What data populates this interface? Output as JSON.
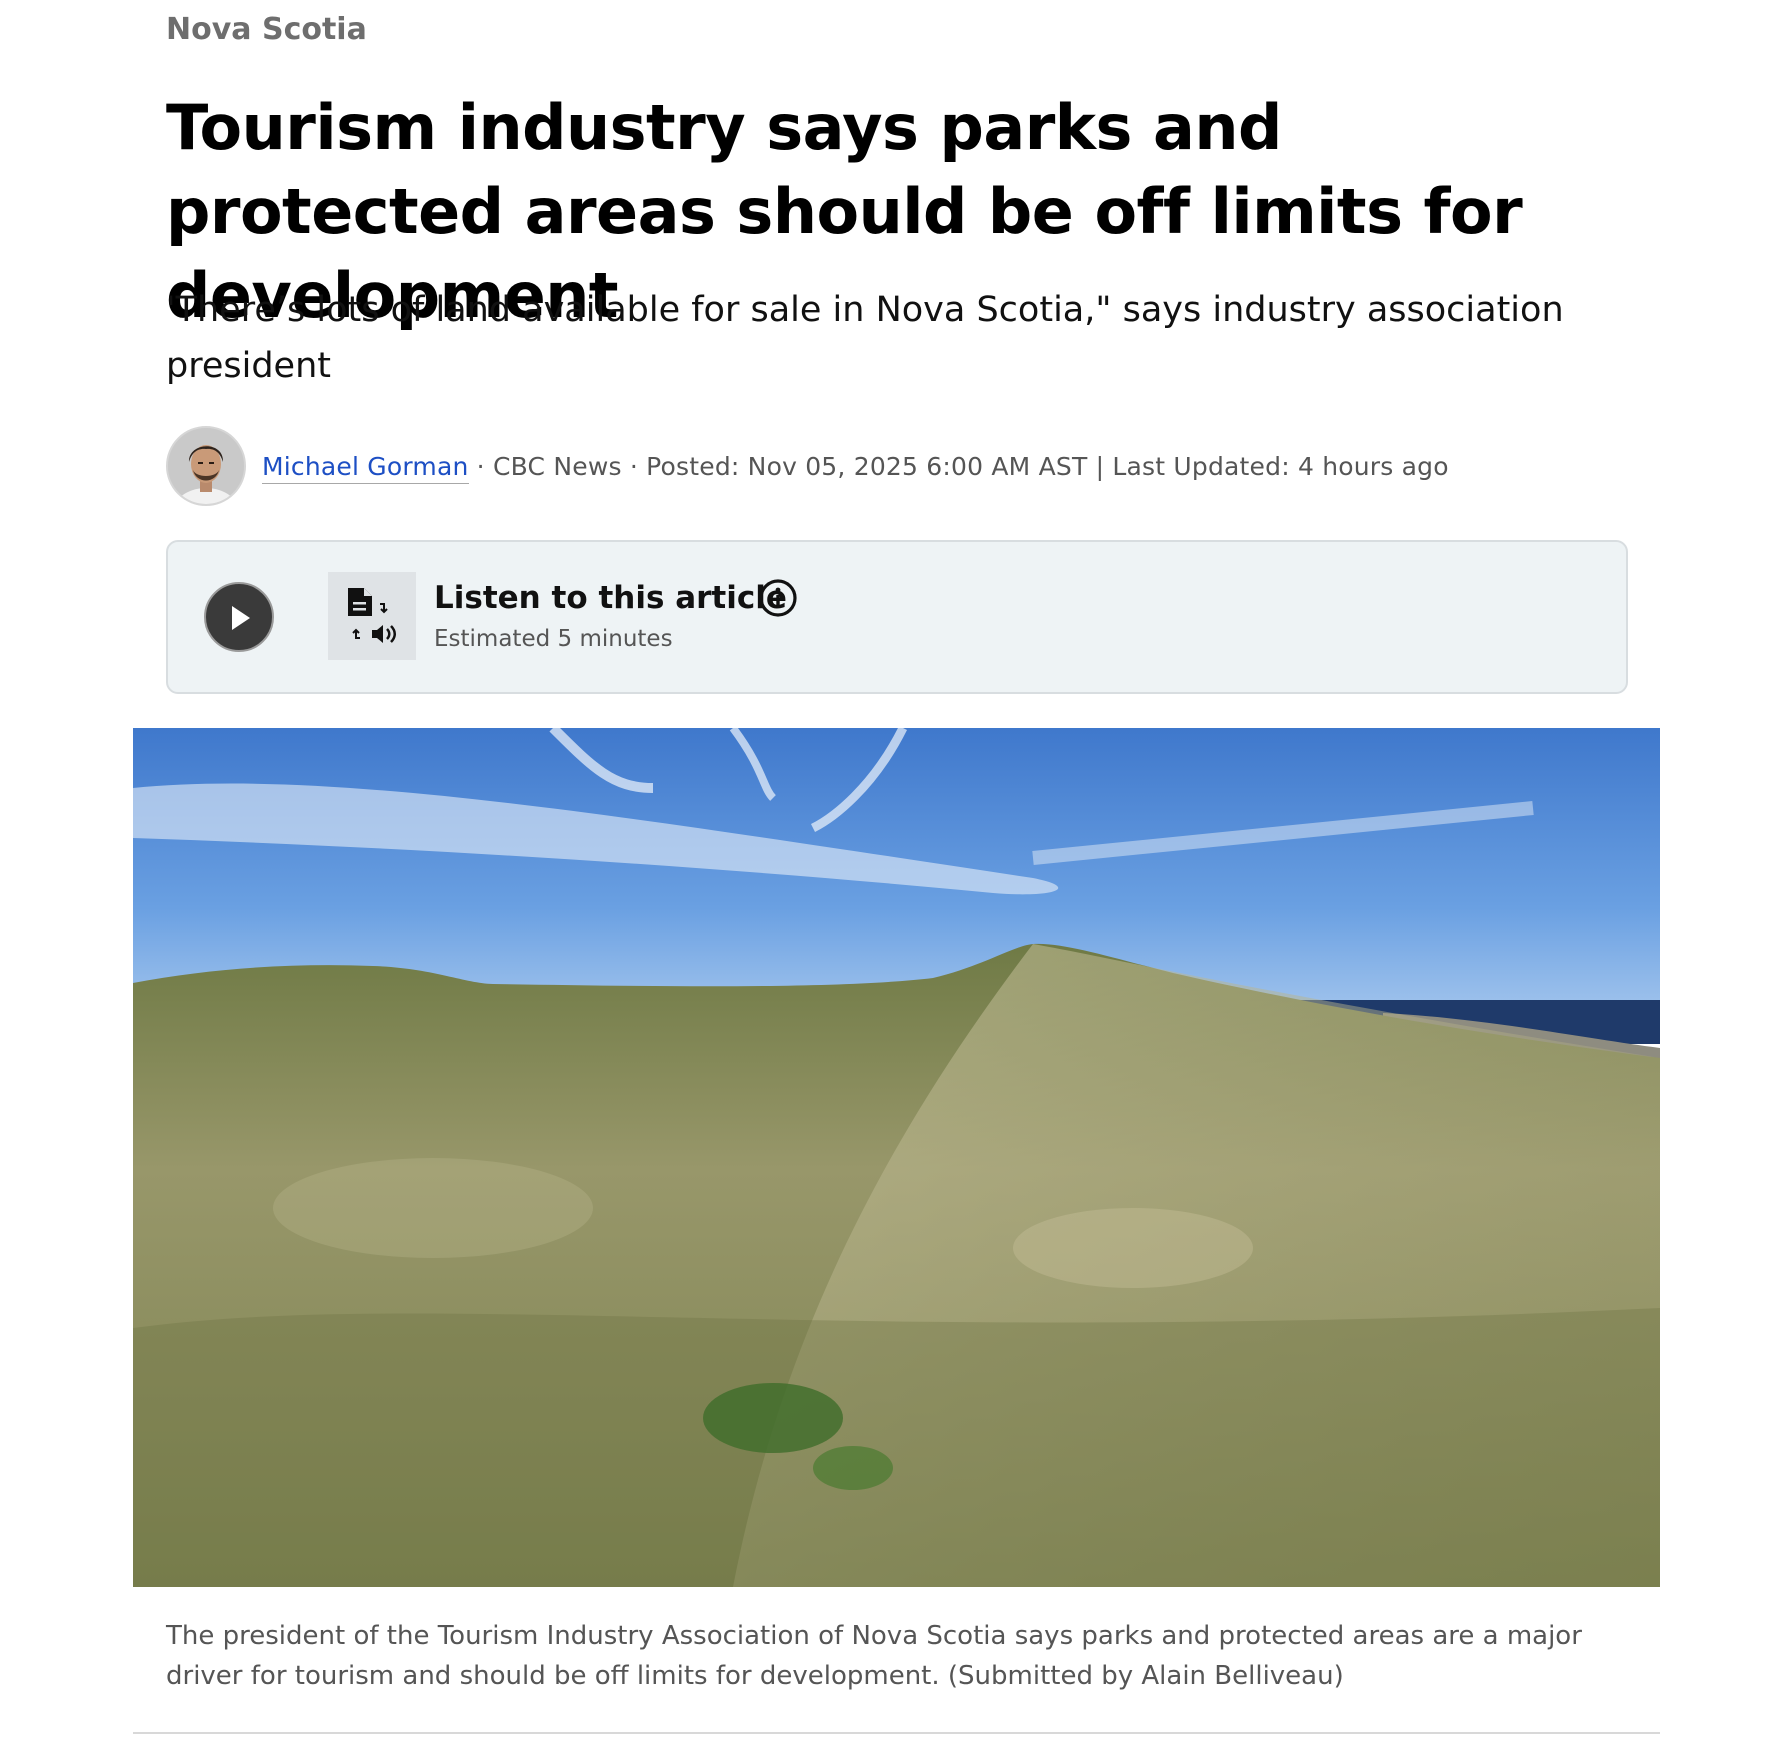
{
  "article": {
    "section": "Nova Scotia",
    "headline": "Tourism industry says parks and protected areas should be off limits for development",
    "dek": "'There’s lots of land available for sale in Nova Scotia,\" says industry association president",
    "byline": {
      "author": "Michael Gorman",
      "outlet": " · CBC News · ",
      "posted": "Posted: Nov 05, 2025 6:00 AM AST",
      "separator": " | ",
      "updated": "Last Updated: 4 hours ago"
    },
    "listen": {
      "title": "Listen to this article",
      "duration": "Estimated 5 minutes",
      "play_icon": "play-icon",
      "tts_icon": "document-to-audio-icon",
      "info_icon": "info-icon"
    },
    "photo": {
      "caption": "The president of the Tourism Industry Association of Nova Scotia says parks and protected areas are a major driver for tourism and should be off limits for development. (Submitted by Alain Belliveau)"
    }
  },
  "colors": {
    "section_text": "#6e6e6e",
    "author_link": "#1d4fc4",
    "listen_box_bg": "#eef3f5",
    "play_button": "#3a3a3a",
    "sky": "#5b8fd6",
    "grass": "#8a8f5a"
  }
}
